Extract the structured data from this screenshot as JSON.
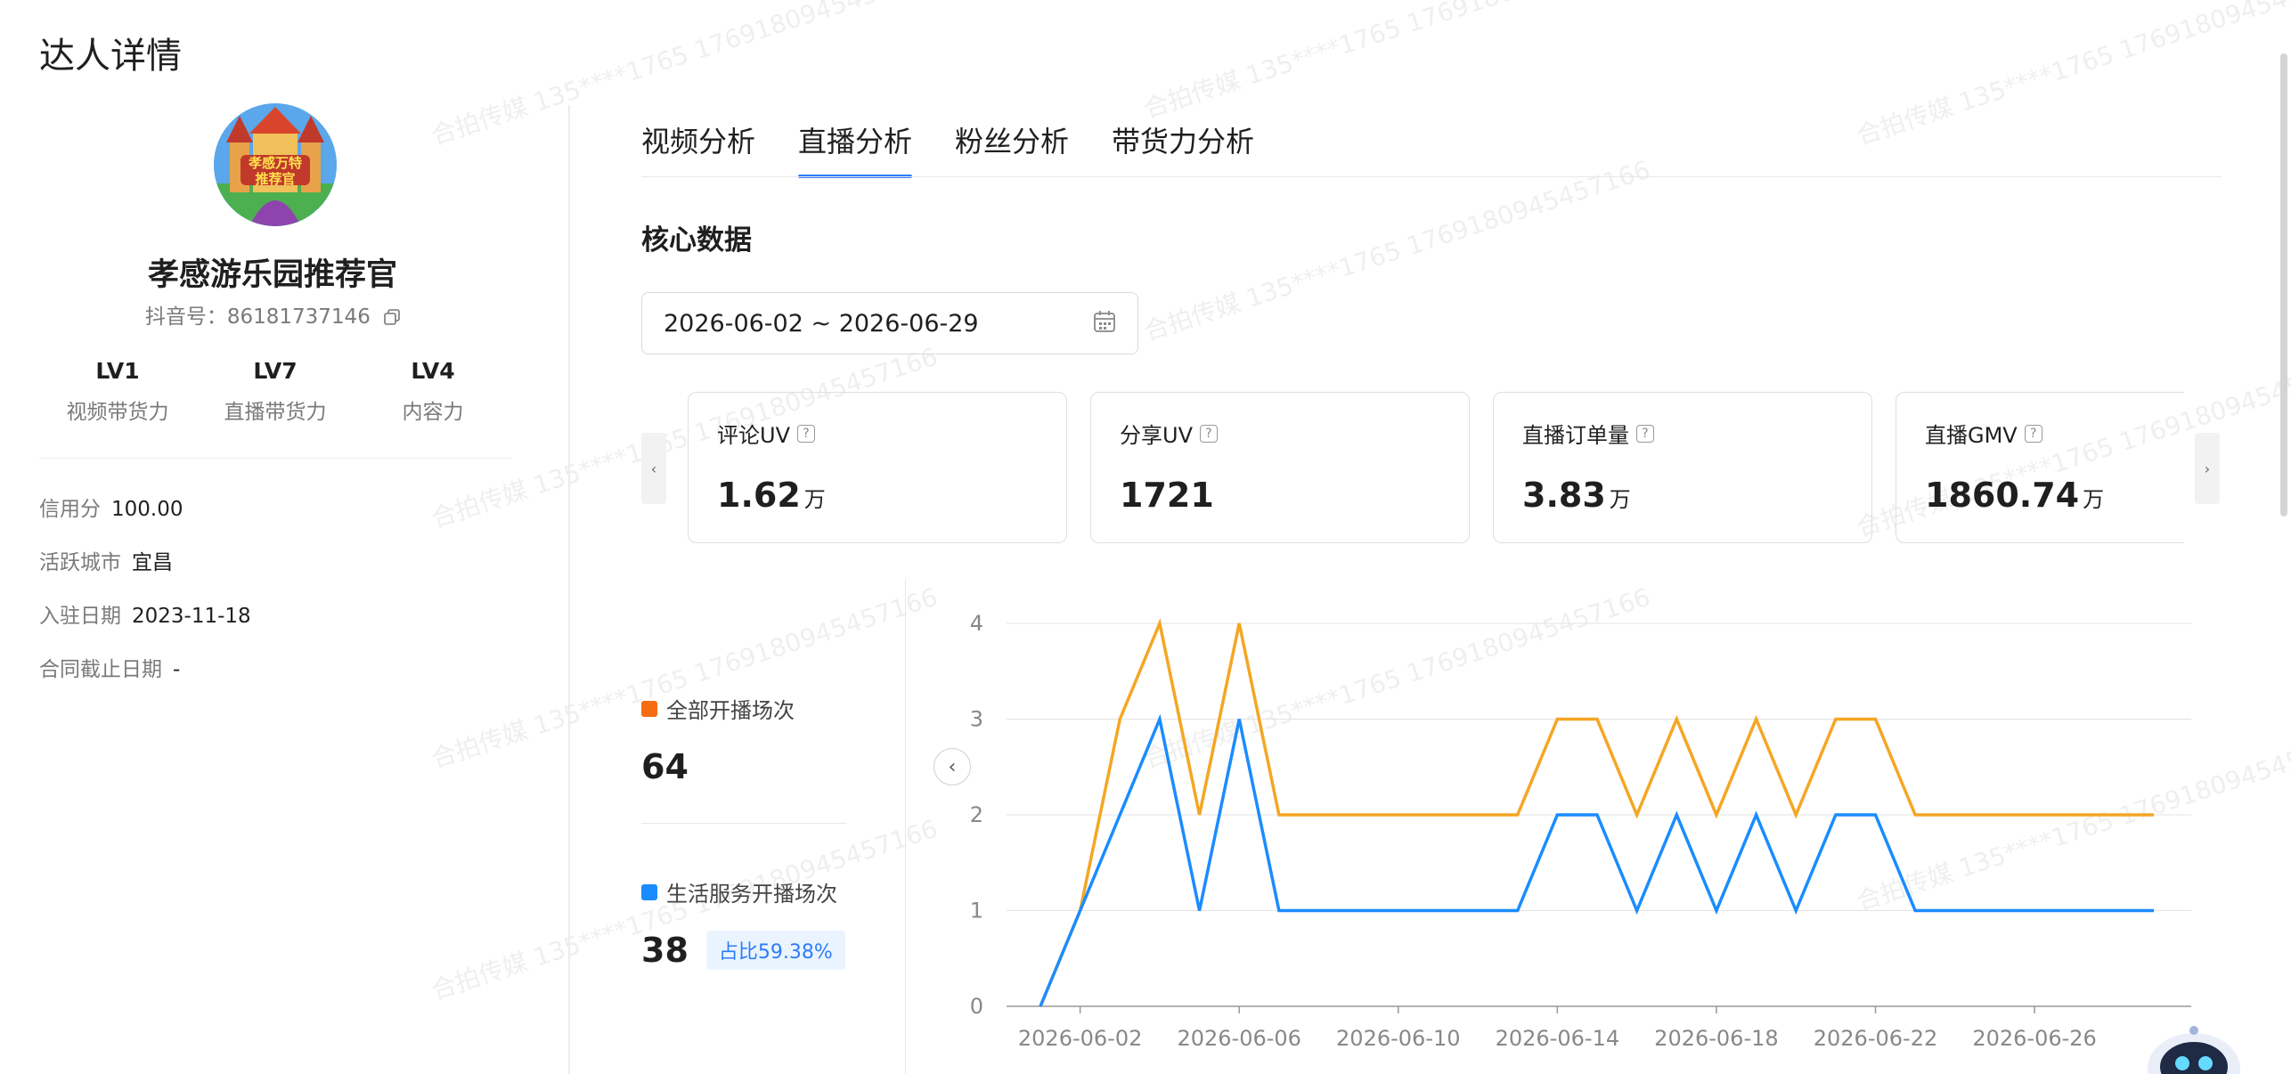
{
  "page": {
    "title": "达人详情"
  },
  "profile": {
    "name": "孝感游乐园推荐官",
    "avatar_text": "孝感万特推荐官",
    "douyin_label": "抖音号：",
    "douyin_id": "86181737146",
    "levels": [
      {
        "value": "LV1",
        "label": "视频带货力"
      },
      {
        "value": "LV7",
        "label": "直播带货力"
      },
      {
        "value": "LV4",
        "label": "内容力"
      }
    ],
    "info": [
      {
        "label": "信用分",
        "value": "100.00"
      },
      {
        "label": "活跃城市",
        "value": "宜昌"
      },
      {
        "label": "入驻日期",
        "value": "2023-11-18"
      },
      {
        "label": "合同截止日期",
        "value": "-"
      }
    ]
  },
  "tabs": [
    {
      "label": "视频分析",
      "active": false
    },
    {
      "label": "直播分析",
      "active": true
    },
    {
      "label": "粉丝分析",
      "active": false
    },
    {
      "label": "带货力分析",
      "active": false
    }
  ],
  "section": {
    "title": "核心数据"
  },
  "date_range": {
    "value": "2026-06-02 ~ 2026-06-29",
    "icon": "calendar-icon"
  },
  "metrics": [
    {
      "label": "评论UV",
      "value": "1.62",
      "unit": "万"
    },
    {
      "label": "分享UV",
      "value": "1721",
      "unit": ""
    },
    {
      "label": "直播订单量",
      "value": "3.83",
      "unit": "万"
    },
    {
      "label": "直播GMV",
      "value": "1860.74",
      "unit": "万"
    }
  ],
  "summary": {
    "all": {
      "label": "全部开播场次",
      "value": "64",
      "color": "#f56c12"
    },
    "life": {
      "label": "生活服务开播场次",
      "value": "38",
      "ratio": "占比59.38%",
      "color": "#1a8cff"
    }
  },
  "watermark": {
    "text": "合拍传媒 135****1765 17691809454571​66"
  },
  "chart_data": {
    "type": "line",
    "x": [
      "2026-06-01",
      "2026-06-02",
      "2026-06-03",
      "2026-06-04",
      "2026-06-05",
      "2026-06-06",
      "2026-06-07",
      "2026-06-08",
      "2026-06-09",
      "2026-06-10",
      "2026-06-11",
      "2026-06-12",
      "2026-06-13",
      "2026-06-14",
      "2026-06-15",
      "2026-06-16",
      "2026-06-17",
      "2026-06-18",
      "2026-06-19",
      "2026-06-20",
      "2026-06-21",
      "2026-06-22",
      "2026-06-23",
      "2026-06-24",
      "2026-06-25",
      "2026-06-26",
      "2026-06-27",
      "2026-06-28",
      "2026-06-29"
    ],
    "x_tick_labels": [
      "2026-06-02",
      "2026-06-06",
      "2026-06-10",
      "2026-06-14",
      "2026-06-18",
      "2026-06-22",
      "2026-06-26"
    ],
    "series": [
      {
        "name": "全部开播场次",
        "color": "#f5a623",
        "values": [
          0,
          1,
          3,
          4,
          2,
          4,
          2,
          2,
          2,
          2,
          2,
          2,
          2,
          3,
          3,
          2,
          3,
          2,
          3,
          2,
          3,
          3,
          2,
          2,
          2,
          2,
          2,
          2,
          2
        ]
      },
      {
        "name": "生活服务开播场次",
        "color": "#1a8cff",
        "values": [
          0,
          1,
          2,
          3,
          1,
          3,
          1,
          1,
          1,
          1,
          1,
          1,
          1,
          2,
          2,
          1,
          2,
          1,
          2,
          1,
          2,
          2,
          1,
          1,
          1,
          1,
          1,
          1,
          1
        ]
      }
    ],
    "ylim": [
      0,
      4
    ],
    "yticks": [
      0,
      1,
      2,
      3,
      4
    ],
    "grid": true,
    "title": "",
    "xlabel": "",
    "ylabel": ""
  }
}
